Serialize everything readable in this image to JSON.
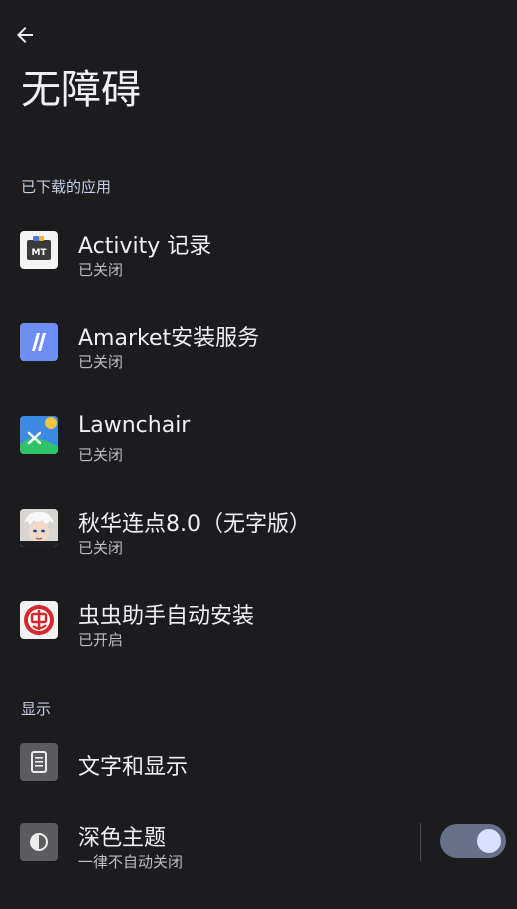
{
  "header": {
    "title": "无障碍",
    "back_icon": "arrow-left-icon"
  },
  "sections": [
    {
      "title": "已下载的应用",
      "items": [
        {
          "label": "Activity 记录",
          "status": "已关闭",
          "icon": "activity-mt-icon"
        },
        {
          "label": "Amarket安装服务",
          "status": "已关闭",
          "icon": "amarket-icon"
        },
        {
          "label": "Lawnchair",
          "status": "已关闭",
          "icon": "lawnchair-icon"
        },
        {
          "label": "秋华连点8.0（无字版）",
          "status": "已关闭",
          "icon": "avatar-app-icon"
        },
        {
          "label": "虫虫助手自动安装",
          "status": "已开启",
          "icon": "chongchong-icon"
        }
      ]
    },
    {
      "title": "显示",
      "items": [
        {
          "label": "文字和显示",
          "icon": "text-display-icon"
        },
        {
          "label": "深色主题",
          "status": "一律不自动关闭",
          "icon": "dark-theme-icon",
          "toggle_on": true
        }
      ]
    }
  ],
  "colors": {
    "background": "#1c1b1d",
    "accent": "#d8e2ff",
    "switch_track": "#66728a"
  }
}
